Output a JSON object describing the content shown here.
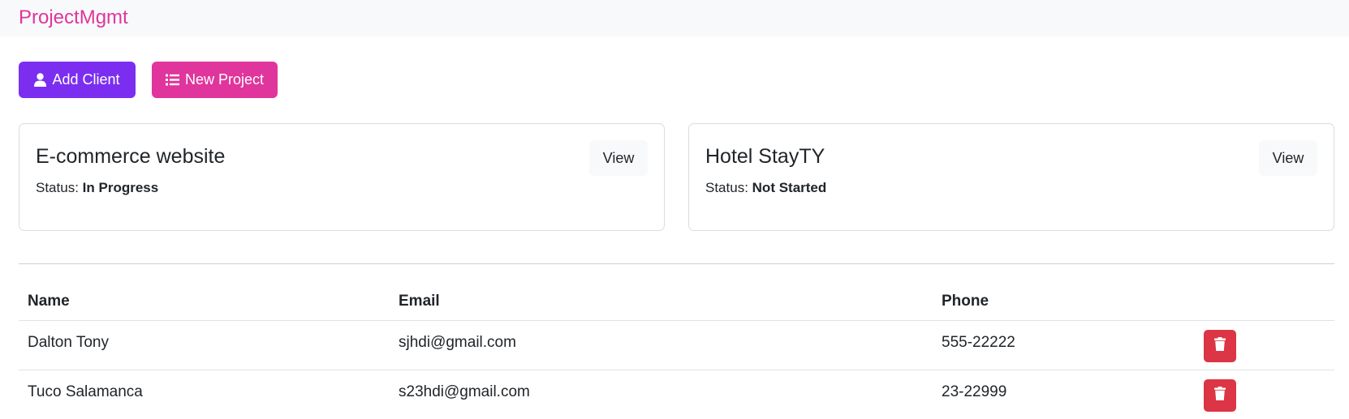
{
  "app": {
    "brand": "ProjectMgmt"
  },
  "toolbar": {
    "add_client_label": "Add Client",
    "new_project_label": "New Project",
    "add_client_color": "#7b2ef0",
    "new_project_color": "#e0359c"
  },
  "projects": [
    {
      "title": "E-commerce website",
      "status_label": "Status:",
      "status": "In Progress",
      "view_label": "View"
    },
    {
      "title": "Hotel StayTY",
      "status_label": "Status:",
      "status": "Not Started",
      "view_label": "View"
    }
  ],
  "clients_table": {
    "headers": {
      "name": "Name",
      "email": "Email",
      "phone": "Phone"
    },
    "rows": [
      {
        "name": "Dalton Tony",
        "email": "sjhdi@gmail.com",
        "phone": "555-22222",
        "action_icon": "trash-icon"
      },
      {
        "name": "Tuco Salamanca",
        "email": "s23hdi@gmail.com",
        "phone": "23-22999",
        "action_icon": "trash-icon"
      }
    ],
    "delete_color": "#dc3545"
  },
  "icons": {
    "add_client": "user-icon",
    "new_project": "list-icon",
    "delete": "trash-icon"
  }
}
